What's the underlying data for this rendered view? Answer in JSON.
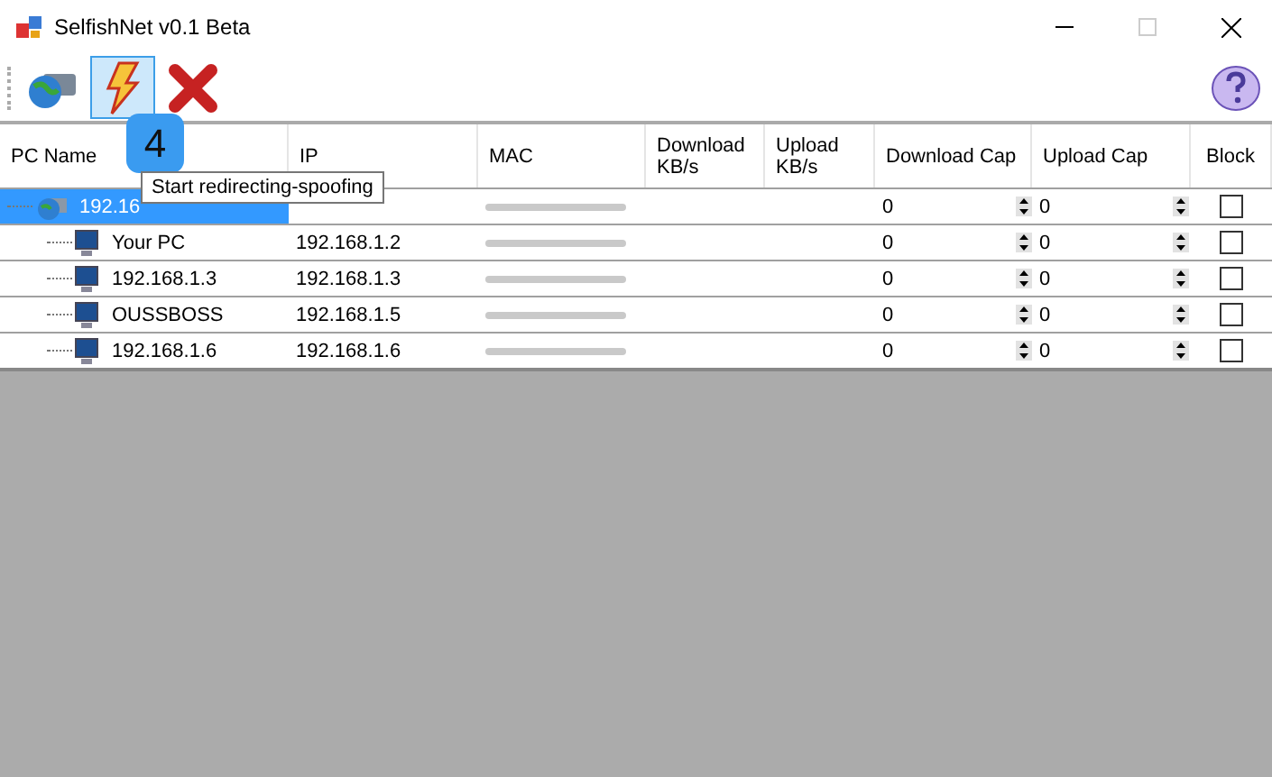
{
  "window": {
    "title": "SelfishNet v0.1 Beta"
  },
  "toolbar": {
    "buttons": [
      {
        "kind": "network",
        "selected": false
      },
      {
        "kind": "start",
        "selected": true
      },
      {
        "kind": "stop",
        "selected": false
      }
    ]
  },
  "step_badge": "4",
  "tooltip": "Start redirecting-spoofing",
  "table": {
    "columns": [
      "PC Name",
      "IP",
      "MAC",
      "Download KB/s",
      "Upload KB/s",
      "Download Cap",
      "Upload Cap",
      "Block"
    ],
    "tree": {
      "name": "192.16",
      "selected": true,
      "download_cap": "0",
      "upload_cap": "0",
      "blocked": false,
      "children": [
        {
          "name": "Your PC",
          "ip": "192.168.1.2",
          "selected": false,
          "download_cap": "0",
          "upload_cap": "0",
          "blocked": false
        },
        {
          "name": "192.168.1.3",
          "ip": "192.168.1.3",
          "selected": false,
          "download_cap": "0",
          "upload_cap": "0",
          "blocked": false
        },
        {
          "name": "OUSSBOSS",
          "ip": "192.168.1.5",
          "selected": false,
          "download_cap": "0",
          "upload_cap": "0",
          "blocked": false
        },
        {
          "name": "192.168.1.6",
          "ip": "192.168.1.6",
          "selected": false,
          "download_cap": "0",
          "upload_cap": "0",
          "blocked": false
        }
      ]
    }
  }
}
